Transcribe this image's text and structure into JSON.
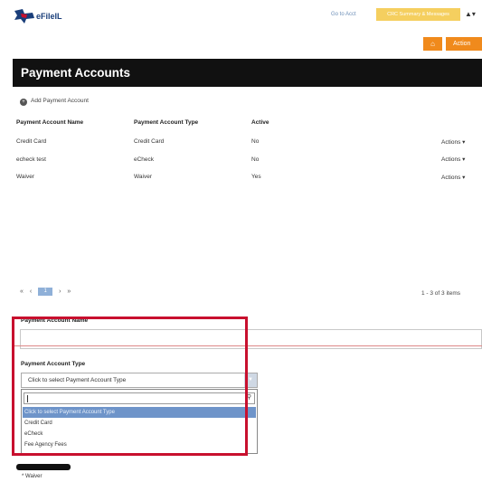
{
  "header": {
    "logo_text": "eFileIL",
    "goto_link": "Go to Acct",
    "yellow_button": "CRC Summary & Messages",
    "user_menu_glyph": "▲▾",
    "home_glyph": "⌂",
    "action_button": "Action"
  },
  "page": {
    "title": "Payment Accounts",
    "add_link": "Add Payment Account"
  },
  "table": {
    "headers": [
      "Payment Account Name",
      "Payment Account Type",
      "Active"
    ],
    "rows": [
      {
        "name": "Credit Card",
        "type": "Credit Card",
        "active": "No",
        "actions": "Actions ▾"
      },
      {
        "name": "echeck test",
        "type": "eCheck",
        "active": "No",
        "actions": "Actions ▾"
      },
      {
        "name": "Waiver",
        "type": "Waiver",
        "active": "Yes",
        "actions": "Actions ▾"
      }
    ]
  },
  "pagination": {
    "first": "«",
    "prev": "‹",
    "current": "1",
    "next": "›",
    "last": "»",
    "summary": "1 - 3 of 3 items"
  },
  "form": {
    "name_label": "Payment Account Name",
    "name_value": "",
    "type_label": "Payment Account Type",
    "type_placeholder": "Click to select Payment Account Type",
    "dropdown_search_value": "",
    "dropdown_options": [
      {
        "label": "Click to select Payment Account Type",
        "selected": true
      },
      {
        "label": "Credit Card",
        "selected": false
      },
      {
        "label": "eCheck",
        "selected": false
      },
      {
        "label": "Fee Agency Fees",
        "selected": false
      }
    ],
    "waiver_label": "* Waiver"
  },
  "colors": {
    "title_bar": "#111111",
    "orange": "#f08a1c",
    "yellow": "#f5cf5f",
    "highlight": "#c8102e",
    "selected_option": "#6e94c9"
  }
}
